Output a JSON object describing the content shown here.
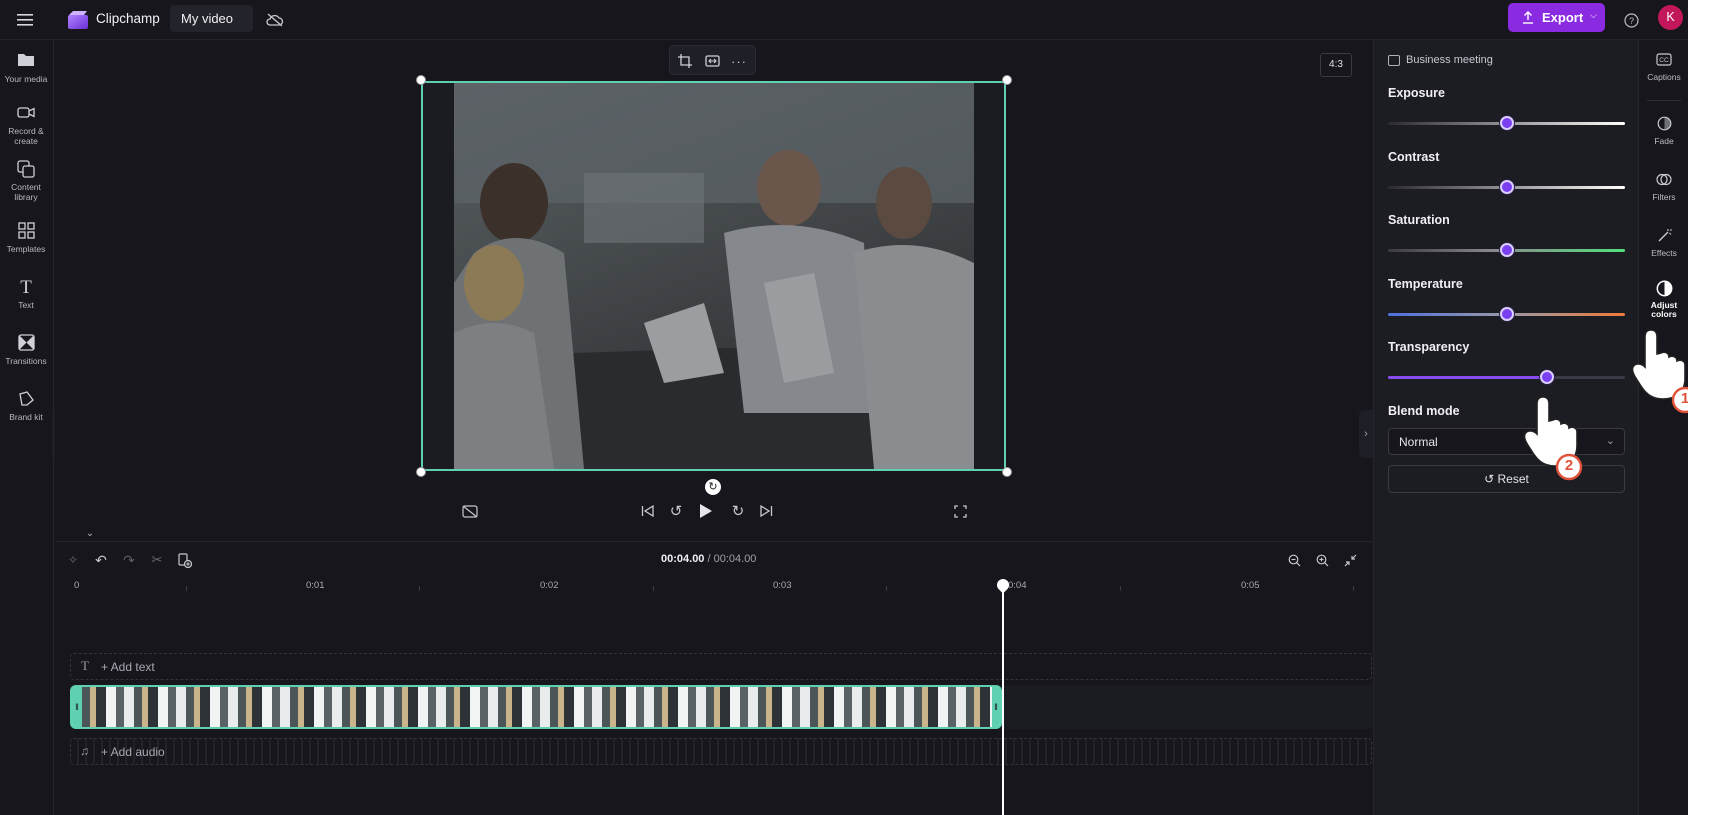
{
  "app": {
    "name": "Clipchamp",
    "project_title": "My video",
    "export_label": "Export",
    "avatar_initial": "K",
    "accent": "#8a2be2"
  },
  "left_nav": {
    "items": [
      {
        "label": "Your media",
        "icon": "folder-icon"
      },
      {
        "label": "Record & create",
        "icon": "video-camera-icon"
      },
      {
        "label": "Content library",
        "icon": "content-library-icon"
      },
      {
        "label": "Templates",
        "icon": "templates-grid-icon"
      },
      {
        "label": "Text",
        "icon": "text-icon"
      },
      {
        "label": "Transitions",
        "icon": "transitions-icon"
      },
      {
        "label": "Brand kit",
        "icon": "brand-kit-icon"
      }
    ]
  },
  "stage": {
    "aspect_ratio": "4:3"
  },
  "timeline": {
    "current_time": "00:04.00",
    "separator": " / ",
    "total_time": "00:04.00",
    "ruler": [
      "0",
      "0:01",
      "0:02",
      "0:03",
      "0:04",
      "0:05"
    ],
    "add_text_label": "+ Add text",
    "add_audio_label": "+ Add audio"
  },
  "adjust_panel": {
    "clip_name": "Business meeting",
    "sliders": [
      {
        "label": "Exposure",
        "value": 0.5
      },
      {
        "label": "Contrast",
        "value": 0.5
      },
      {
        "label": "Saturation",
        "value": 0.5
      },
      {
        "label": "Temperature",
        "value": 0.5
      },
      {
        "label": "Transparency",
        "value": 0.67
      }
    ],
    "blend_mode_label": "Blend mode",
    "blend_mode_value": "Normal",
    "reset_label": "Reset"
  },
  "right_tabs": {
    "items": [
      {
        "label": "Captions",
        "icon": "captions-icon"
      },
      {
        "label": "Fade",
        "icon": "fade-icon"
      },
      {
        "label": "Filters",
        "icon": "filters-icon"
      },
      {
        "label": "Effects",
        "icon": "effects-wand-icon"
      },
      {
        "label": "Adjust colors",
        "icon": "adjust-colors-icon"
      }
    ]
  },
  "callouts": {
    "step1": "1",
    "step2": "2"
  }
}
